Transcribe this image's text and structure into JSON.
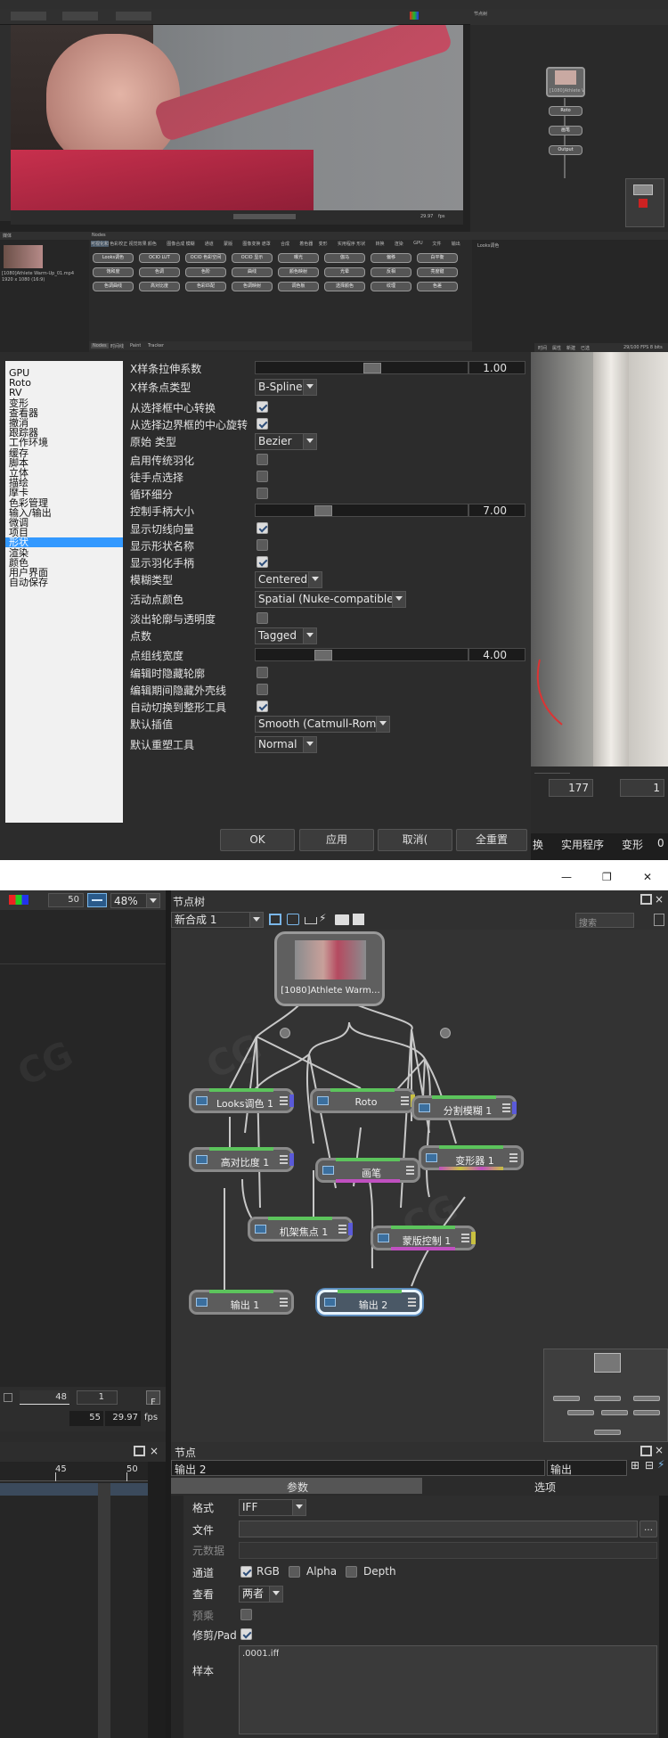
{
  "top": {
    "window_title_bar": "",
    "viewer_status": {
      "frame": "29.97",
      "fps": "fps"
    },
    "media_panel_title": "媒体",
    "node_panel_title": "Nodes",
    "tree_panel_title": "节点树",
    "tree_panel_title2": "节点",
    "toolbox_tabs": [
      "Nodes",
      "时间线",
      "Paint",
      "Tracker"
    ],
    "toolbox_categories": [
      "可视化和叠加",
      "色彩校正",
      "视觉效果",
      "颜色",
      "图像合成",
      "模糊",
      "通道",
      "蒙版",
      "图像变换",
      "遮罩",
      "合成",
      "着色器",
      "变形",
      "实用程序",
      "形状",
      "转换",
      "渲染",
      "GPU",
      "文件",
      "输出"
    ],
    "toolbox_nodes": [
      "Looks调色",
      "OCIO LUT",
      "OCIO 色彩空间",
      "OCIO 显示",
      "曝光",
      "伽马",
      "偏移",
      "白平衡",
      "饱和度",
      "色调",
      "色阶",
      "曲线",
      "颜色映射",
      "光晕",
      "反相",
      "亮度键",
      "色调曲线",
      "高对比度",
      "色彩匹配",
      "色调映射",
      "调色板",
      "选择颜色",
      "纹理",
      "色差"
    ],
    "media_item": "[1080]Athlete Warm-Up_01.mp4",
    "media_item2": "1920 x 1080 (16:9)",
    "right_tabs": [
      "时间",
      "属性",
      "新建",
      "已选"
    ],
    "right_info": "29/100 FPS 8 bits",
    "right_bottom": {
      "v1": "177",
      "v2": "1",
      "a": "换",
      "b": "实用程序",
      "c": "变形",
      "d": "0"
    },
    "mini_tree_nodes": [
      "[1080]Athlete Warm",
      "Roto",
      "画笔",
      "Output"
    ],
    "small_node_strip": "Looks调色"
  },
  "prefs": {
    "categories": [
      "GPU",
      "Roto",
      "RV",
      "变形",
      "查看器",
      "撤消",
      "跟踪器",
      "工作环境",
      "缓存",
      "脚本",
      "立体",
      "描绘",
      "摩卡",
      "色彩管理",
      "输入/输出",
      "微调",
      "项目",
      "形状",
      "渲染",
      "颜色",
      "用户界面",
      "自动保存"
    ],
    "selected_index": 17,
    "rows": {
      "x_tension": {
        "label": "X样条拉伸系数",
        "value": "1.00"
      },
      "x_type": {
        "label": "X样条点类型",
        "value": "B-Spline"
      },
      "scale_center": {
        "label": "从选择框中心转换"
      },
      "rotate_center": {
        "label": "从选择边界框的中心旋转"
      },
      "prim_type": {
        "label": "原始 类型",
        "value": "Bezier"
      },
      "legacy_feather": {
        "label": "启用传统羽化"
      },
      "freehand": {
        "label": "徒手点选择"
      },
      "loop_sub": {
        "label": "循环细分"
      },
      "handle_size": {
        "label": "控制手柄大小",
        "value": "7.00"
      },
      "show_tangent": {
        "label": "显示切线向量"
      },
      "show_name": {
        "label": "显示形状名称"
      },
      "show_feather": {
        "label": "显示羽化手柄"
      },
      "blur_type": {
        "label": "模糊类型",
        "value": "Centered"
      },
      "active_color": {
        "label": "活动点颜色",
        "value": "Spatial (Nuke-compatible)"
      },
      "fade_outline": {
        "label": "淡出轮廓与透明度"
      },
      "pt_count": {
        "label": "点数",
        "value": "Tagged"
      },
      "pt_width": {
        "label": "点组线宽度",
        "value": "4.00"
      },
      "hide_outline": {
        "label": "编辑时隐藏轮廓"
      },
      "hide_shell": {
        "label": "编辑期间隐藏外壳线"
      },
      "auto_switch": {
        "label": "自动切换到整形工具"
      },
      "interp": {
        "label": "默认插值",
        "value": "Smooth (Catmull-Rom)"
      },
      "reshape_tool": {
        "label": "默认重塑工具",
        "value": "Normal"
      }
    },
    "buttons": {
      "ok": "OK",
      "apply": "应用",
      "cancel": "取消(",
      "reset": "全重置"
    }
  },
  "bottom": {
    "window_controls": [
      "—",
      "❐",
      "✕"
    ],
    "viewer_toolbar": {
      "num": "50",
      "zoom": "48%"
    },
    "node_tree": {
      "title": "节点树",
      "composite": "新合成 1",
      "search_placeholder": "搜索",
      "nodes": {
        "source": "[1080]Athlete Warm…",
        "looks": "Looks调色 1",
        "roto": "Roto",
        "split_blur": "分割模糊 1",
        "high_contrast": "高对比度 1",
        "paint": "画笔",
        "warp": "变形器 1",
        "cam_focus": "机架焦点 1",
        "mask_ctrl": "蒙版控制 1",
        "out1": "输出 1",
        "out2": "输出 2"
      }
    },
    "timeline": {
      "frame": "48",
      "step": "1",
      "f": "F",
      "end": "55",
      "fps_val": "29.97",
      "fps": "fps",
      "ruler": [
        "45",
        "50"
      ]
    },
    "node_props": {
      "title": "节点",
      "node_name": "输出 2",
      "node_type": "输出",
      "tabs": [
        "参数",
        "选项"
      ],
      "format_label": "格式",
      "format_value": "IFF",
      "file_label": "文件",
      "meta_label": "元数据",
      "channels_label": "通道",
      "ch_rgb": "RGB",
      "ch_alpha": "Alpha",
      "ch_depth": "Depth",
      "view_label": "查看",
      "view_value": "两者",
      "premult_label": "预乘",
      "crop_label": "修剪/Pad",
      "sample_label": "样本",
      "sample_value": ".0001.iff"
    }
  },
  "colors": {
    "accent_blue": "#7ab6e8",
    "selected": "#3a4552",
    "green_port": "#5cc45c",
    "magenta_port": "#c050c0",
    "yellow_port": "#c8c040",
    "blue_port": "#5a5ad8"
  }
}
